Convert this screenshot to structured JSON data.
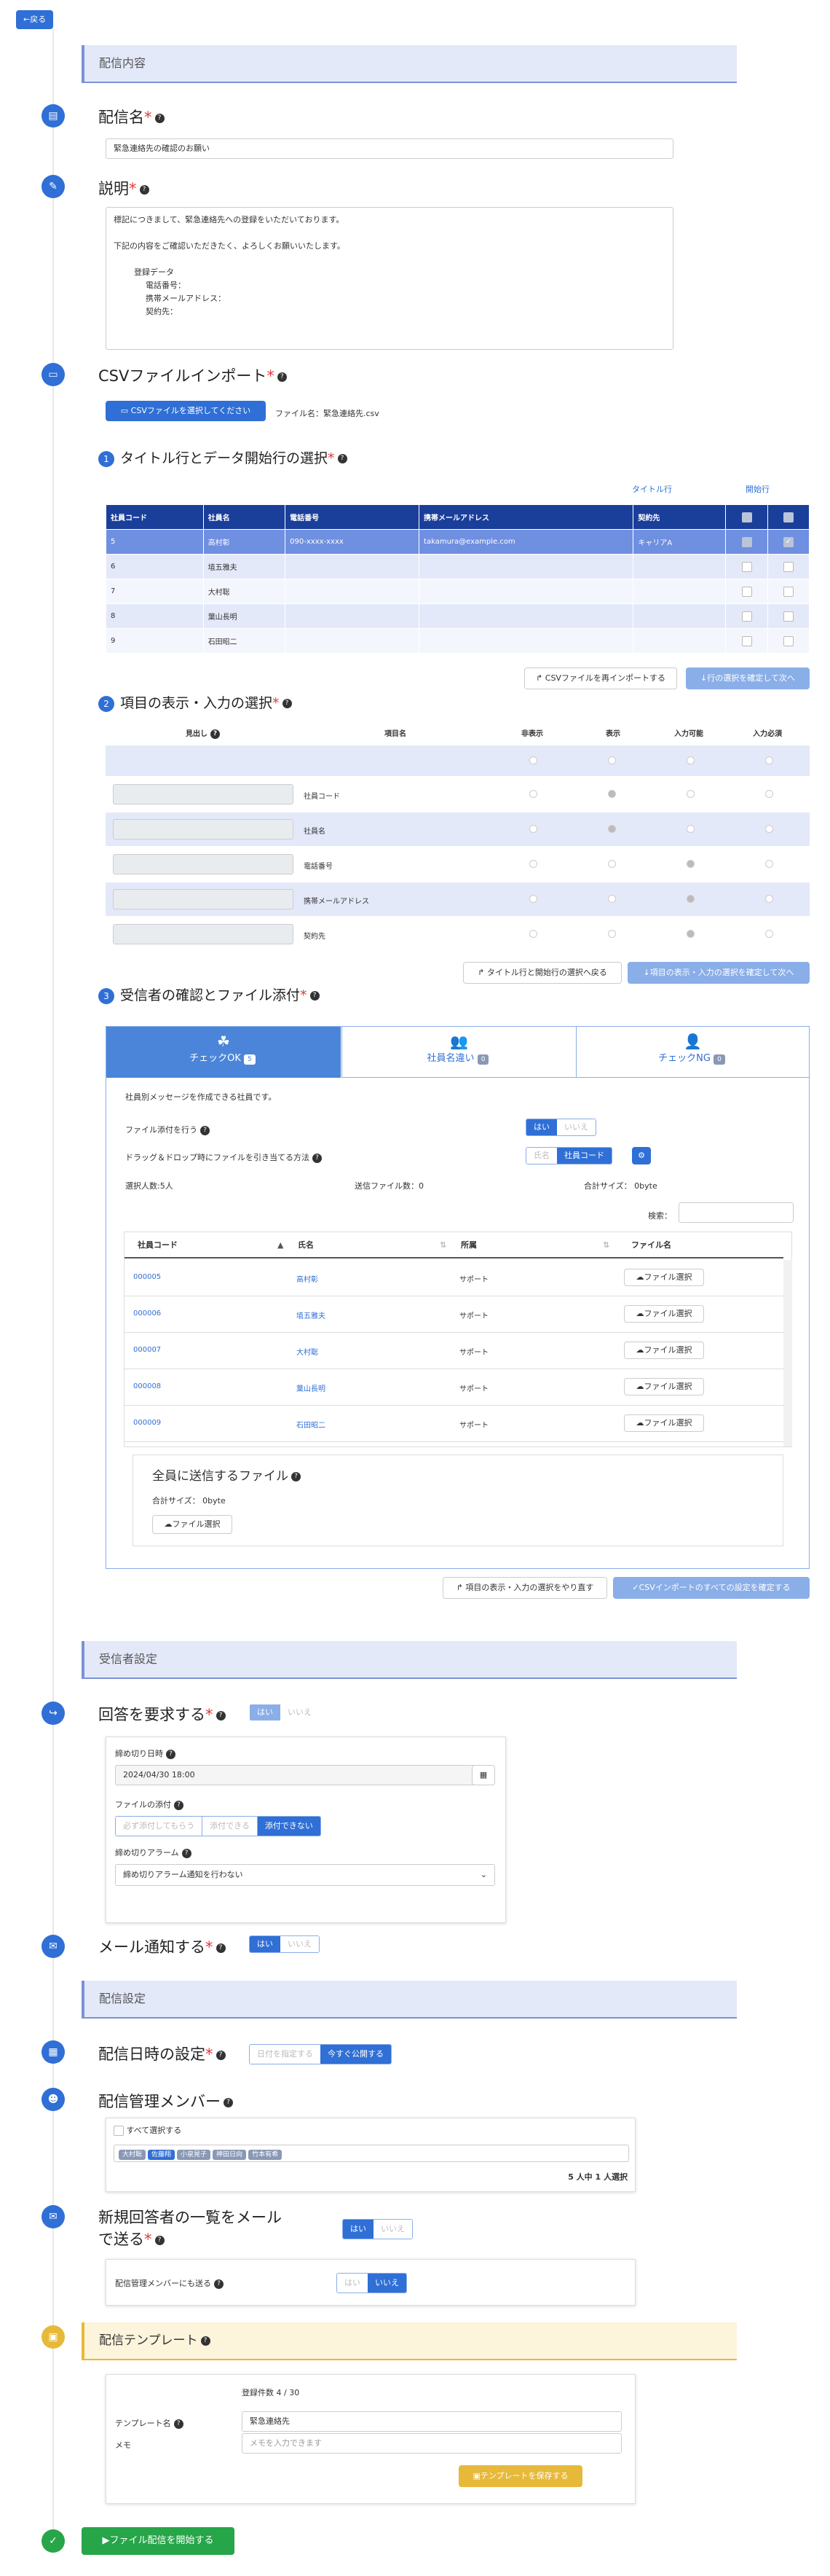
{
  "back_button": "←戻る",
  "sections": {
    "delivery": "配信内容",
    "recipient": "受信者設定",
    "distribution": "配信設定",
    "template": "配信テンプレート"
  },
  "name": {
    "label": "配信名",
    "value": "緊急連絡先の確認のお願い"
  },
  "desc": {
    "label": "説明",
    "lines": [
      "標記につきまして、緊急連絡先への登録をいただいております。",
      "下記の内容をご確認いただきたく、よろしくお願いいたします。",
      "登録データ",
      "電話番号：",
      "携帯メールアドレス：",
      "契約先："
    ]
  },
  "csv": {
    "label": "CSVファイルインポート",
    "select_btn": "CSVファイルを選択してください",
    "file_name": "ファイル名：緊急連絡先.csv"
  },
  "step1": {
    "num": "1",
    "label": "タイトル行とデータ開始行の選択",
    "col_title": "タイトル行",
    "col_start": "開始行",
    "headers": [
      "社員コード",
      "社員名",
      "電話番号",
      "携帯メールアドレス",
      "契約先"
    ],
    "rows": [
      [
        "5",
        "高村彰",
        "090-xxxx-xxxx",
        "takamura@example.com",
        "キャリアA"
      ],
      [
        "6",
        "埴五雅夫",
        "",
        "",
        ""
      ],
      [
        "7",
        "大村聡",
        "",
        "",
        ""
      ],
      [
        "8",
        "葉山長明",
        "",
        "",
        ""
      ],
      [
        "9",
        "石田昭二",
        "",
        "",
        ""
      ]
    ],
    "reimport": "CSVファイルを再インポートする",
    "confirm": "行の選択を確定して次へ"
  },
  "step2": {
    "num": "2",
    "label": "項目の表示・入力の選択",
    "h_caption": "見出し",
    "h_item": "項目名",
    "h_hidden": "非表示",
    "h_show": "表示",
    "h_input": "入力可能",
    "h_required": "入力必須",
    "items": [
      "",
      "社員コード",
      "社員名",
      "電話番号",
      "携帯メールアドレス",
      "契約先"
    ],
    "back": "タイトル行と開始行の選択へ戻る",
    "confirm": "項目の表示・入力の選択を確定して次へ"
  },
  "step3": {
    "num": "3",
    "label": "受信者の確認とファイル添付",
    "tabs": [
      {
        "label": "チェックOK",
        "count": "5"
      },
      {
        "label": "社員名違い",
        "count": "0"
      },
      {
        "label": "チェックNG",
        "count": "0"
      }
    ],
    "note": "社員別メッセージを作成できる社員です。",
    "attach_label": "ファイル添付を行う",
    "yes": "はい",
    "no": "いいえ",
    "dnd_label": "ドラッグ＆ドロップ時にファイルを引き当てる方法",
    "name_opt": "氏名",
    "code_opt": "社員コード",
    "selected": "選択人数:5人",
    "sent_files": "送信ファイル数：0",
    "total_size": "合計サイズ：",
    "total_size_val": "0byte",
    "search_label": "検索：",
    "cols": [
      "社員コード",
      "氏名",
      "所属",
      "ファイル名"
    ],
    "rows": [
      [
        "000005",
        "高村彰",
        "サポート"
      ],
      [
        "000006",
        "埴五雅夫",
        "サポート"
      ],
      [
        "000007",
        "大村聡",
        "サポート"
      ],
      [
        "000008",
        "葉山長明",
        "サポート"
      ],
      [
        "000009",
        "石田昭二",
        "サポート"
      ]
    ],
    "file_btn": "ファイル選択",
    "all_file_title": "全員に送信するファイル",
    "all_size": "合計サイズ：",
    "all_size_val": "0byte",
    "redo": "項目の表示・入力の選択をやり直す",
    "confirm_all": "CSVインポートのすべての設定を確定する"
  },
  "answer": {
    "label": "回答を要求する",
    "yes": "はい",
    "no": "いいえ",
    "deadline_label": "締め切り日時",
    "deadline_value": "2024/04/30 18:00",
    "attach_label": "ファイルの添付",
    "attach_opts": [
      "必ず添付してもらう",
      "添付できる",
      "添付できない"
    ],
    "alarm_label": "締め切りアラーム",
    "alarm_value": "締め切りアラーム通知を行わない"
  },
  "mail": {
    "label": "メール通知する",
    "yes": "はい",
    "no": "いいえ"
  },
  "schedule": {
    "label": "配信日時の設定",
    "opt1": "日付を指定する",
    "opt2": "今すぐ公開する"
  },
  "members": {
    "label": "配信管理メンバー",
    "select_all": "すべて選択する",
    "badges": [
      "大村聡",
      "佐藤翔",
      "小泉晃子",
      "神田日向",
      "竹本有希"
    ],
    "count": "5 人中 1 人選択"
  },
  "newmail": {
    "label1": "新規回答者の一覧をメール",
    "label2": "で送る",
    "yes": "はい",
    "no": "いいえ",
    "manager_label": "配信管理メンバーにも送る",
    "m_yes": "はい",
    "m_no": "いいえ"
  },
  "template": {
    "count_label": "登録件数",
    "count": "4 / 30",
    "name_label": "テンプレート名",
    "name_value": "緊急連絡先",
    "memo_label": "メモ",
    "memo_placeholder": "メモを入力できます",
    "save": "テンプレートを保存する"
  },
  "start": "ファイル配信を開始する"
}
